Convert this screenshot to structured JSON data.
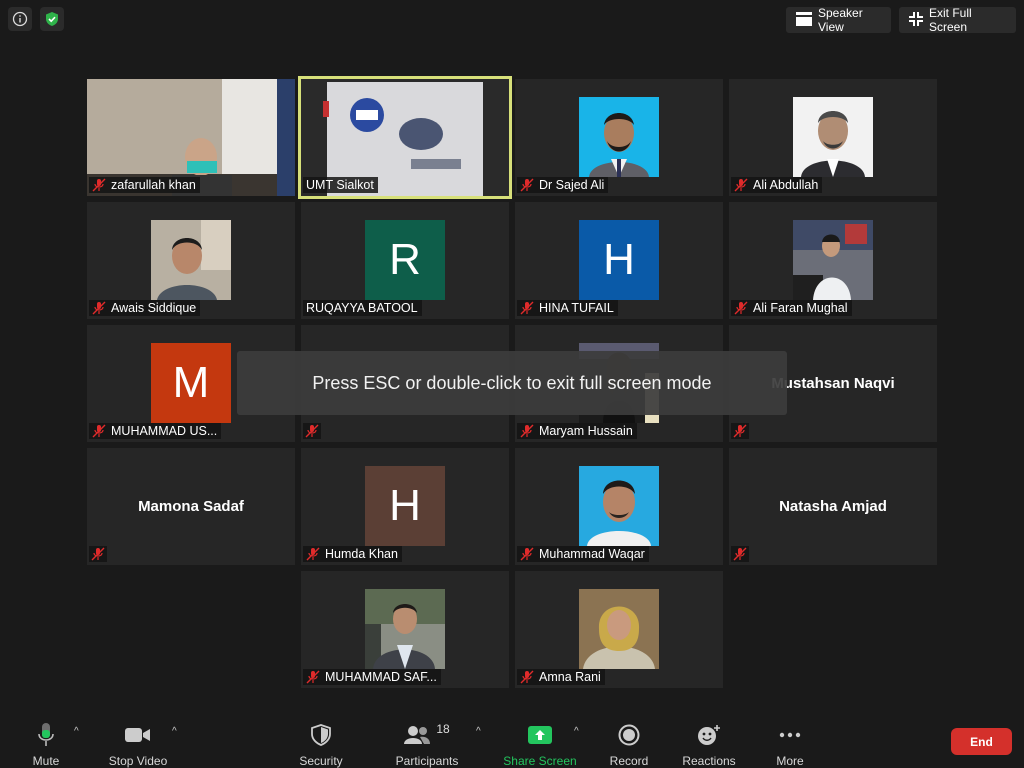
{
  "topbar": {
    "speaker_view_label": "Speaker View",
    "exit_fullscreen_label": "Exit Full Screen"
  },
  "overlay_text": "Press ESC or double-click to exit full screen mode",
  "participants": [
    {
      "name": "zafarullah khan",
      "kind": "photo"
    },
    {
      "name": "UMT Sialkot",
      "kind": "photo",
      "active": true
    },
    {
      "name": "Dr Sajed Ali",
      "kind": "photo"
    },
    {
      "name": "Ali Abdullah",
      "kind": "photo"
    },
    {
      "name": "Awais Siddique",
      "kind": "photo"
    },
    {
      "name": "RUQAYYA BATOOL",
      "kind": "letter",
      "letter": "R",
      "color": "#0e5e4a"
    },
    {
      "name": "HINA TUFAIL",
      "kind": "letter",
      "letter": "H",
      "color": "#0a5aa8"
    },
    {
      "name": "Ali Faran Mughal",
      "kind": "photo"
    },
    {
      "name": "MUHAMMAD US...",
      "kind": "letter",
      "letter": "M",
      "color": "#c4380f"
    },
    {
      "name": "",
      "kind": "hidden"
    },
    {
      "name": "Maryam Hussain",
      "kind": "photo"
    },
    {
      "name": "Mustahsan Naqvi",
      "kind": "name-center"
    },
    {
      "name": "Mamona Sadaf",
      "kind": "name-center"
    },
    {
      "name": "Humda Khan",
      "kind": "letter",
      "letter": "H",
      "color": "#5b3f35"
    },
    {
      "name": "Muhammad Waqar",
      "kind": "photo"
    },
    {
      "name": "Natasha Amjad",
      "kind": "name-center"
    },
    {
      "name": "MUHAMMAD SAF...",
      "kind": "photo"
    },
    {
      "name": "Amna Rani",
      "kind": "photo"
    }
  ],
  "toolbar": {
    "mute": "Mute",
    "stop_video": "Stop Video",
    "security": "Security",
    "participants": "Participants",
    "participants_count": "18",
    "share_screen": "Share Screen",
    "record": "Record",
    "reactions": "Reactions",
    "more": "More",
    "end": "End"
  },
  "colors": {
    "background": "#1a1a1a",
    "tile": "#262626",
    "active_outline": "#d7e07a",
    "share_green": "#23c55e",
    "end_red": "#d4302b"
  }
}
